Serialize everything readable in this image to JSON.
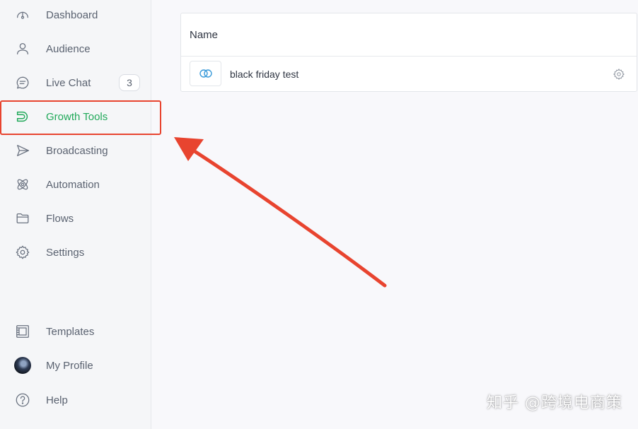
{
  "sidebar": {
    "items": [
      {
        "label": "Dashboard",
        "icon": "gauge-icon"
      },
      {
        "label": "Audience",
        "icon": "person-icon"
      },
      {
        "label": "Live Chat",
        "icon": "chat-bubble-icon",
        "badge": "3"
      },
      {
        "label": "Growth Tools",
        "icon": "magnet-icon",
        "active": true
      },
      {
        "label": "Broadcasting",
        "icon": "send-icon"
      },
      {
        "label": "Automation",
        "icon": "atom-icon"
      },
      {
        "label": "Flows",
        "icon": "folder-icon"
      },
      {
        "label": "Settings",
        "icon": "gear-icon"
      }
    ],
    "bottom_items": [
      {
        "label": "Templates",
        "icon": "template-icon"
      },
      {
        "label": "My Profile",
        "icon": "avatar"
      },
      {
        "label": "Help",
        "icon": "help-icon"
      }
    ]
  },
  "table": {
    "header": "Name",
    "rows": [
      {
        "name": "black friday test",
        "icon": "link-rings-icon"
      }
    ]
  },
  "annotation": {
    "highlight_color": "#e8442f",
    "arrow_color": "#e8442f"
  },
  "watermark": "知乎 @跨境电商策",
  "colors": {
    "accent": "#21a95a",
    "sidebar_bg": "#f5f6f8",
    "main_bg": "#f8f8fb"
  }
}
